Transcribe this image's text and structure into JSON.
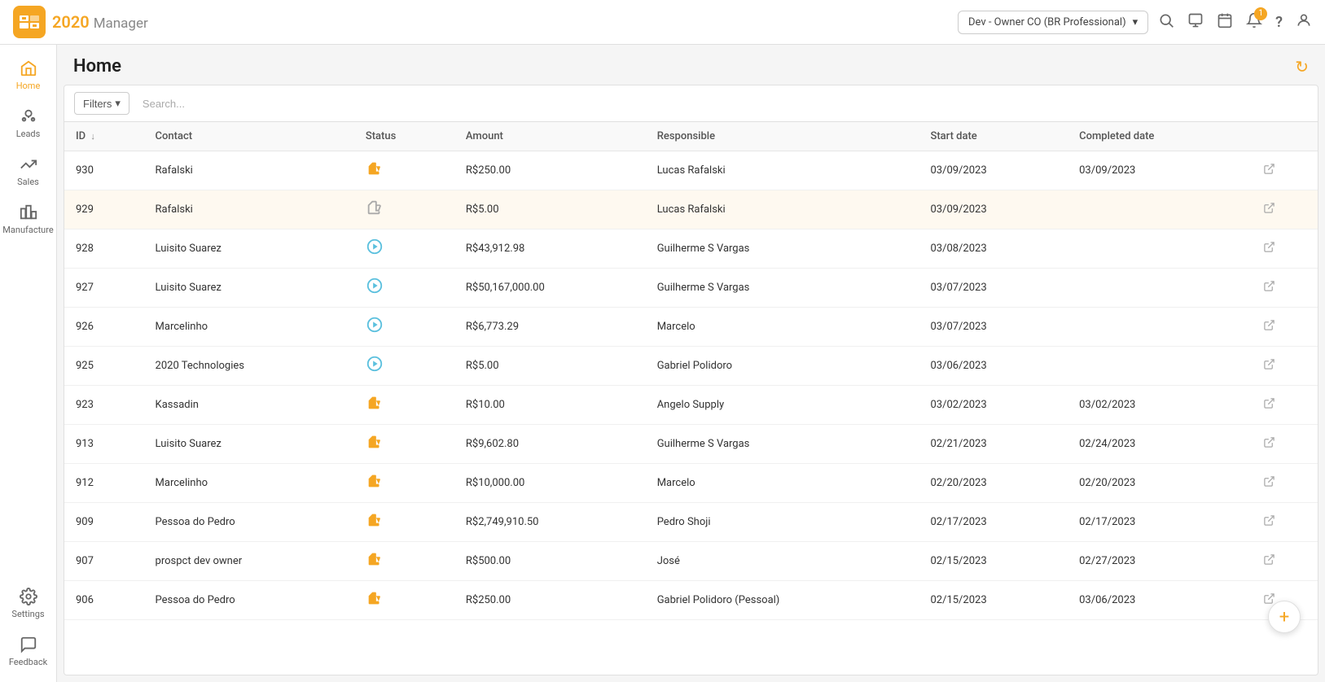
{
  "app": {
    "logo_number": "20",
    "logo_suffix": "20",
    "logo_sub": "Manager"
  },
  "topnav": {
    "env_label": "Dev - Owner CO (BR Professional)",
    "env_chevron": "▾",
    "search_icon": "🔍",
    "chat_icon": "💬",
    "calendar_icon": "📅",
    "notification_icon": "🔔",
    "notification_count": "1",
    "help_icon": "?",
    "user_icon": "👤"
  },
  "sidebar": {
    "home_label": "Home",
    "leads_label": "Leads",
    "sales_label": "Sales",
    "manufacture_label": "Manufacture",
    "settings_label": "Settings",
    "feedback_label": "Feedback"
  },
  "page": {
    "title": "Home",
    "refresh_icon": "↻"
  },
  "filters": {
    "button_label": "Filters",
    "search_placeholder": "Search..."
  },
  "table": {
    "columns": [
      {
        "key": "id",
        "label": "ID",
        "sortable": true,
        "sort_dir": "↓"
      },
      {
        "key": "contact",
        "label": "Contact"
      },
      {
        "key": "status",
        "label": "Status"
      },
      {
        "key": "amount",
        "label": "Amount"
      },
      {
        "key": "responsible",
        "label": "Responsible"
      },
      {
        "key": "start_date",
        "label": "Start date"
      },
      {
        "key": "completed_date",
        "label": "Completed date"
      },
      {
        "key": "actions",
        "label": ""
      }
    ],
    "rows": [
      {
        "id": "930",
        "contact": "Rafalski",
        "status": "approved",
        "amount": "R$250.00",
        "responsible": "Lucas Rafalski",
        "start_date": "03/09/2023",
        "completed_date": "03/09/2023",
        "highlighted": false
      },
      {
        "id": "929",
        "contact": "Rafalski",
        "status": "processing",
        "amount": "R$5.00",
        "responsible": "Lucas Rafalski",
        "start_date": "03/09/2023",
        "completed_date": "",
        "highlighted": true
      },
      {
        "id": "928",
        "contact": "Luisito Suarez",
        "status": "pending",
        "amount": "R$43,912.98",
        "responsible": "Guilherme S Vargas",
        "start_date": "03/08/2023",
        "completed_date": "",
        "highlighted": false
      },
      {
        "id": "927",
        "contact": "Luisito Suarez",
        "status": "pending",
        "amount": "R$50,167,000.00",
        "responsible": "Guilherme S Vargas",
        "start_date": "03/07/2023",
        "completed_date": "",
        "highlighted": false
      },
      {
        "id": "926",
        "contact": "Marcelinho",
        "status": "pending",
        "amount": "R$6,773.29",
        "responsible": "Marcelo",
        "start_date": "03/07/2023",
        "completed_date": "",
        "highlighted": false
      },
      {
        "id": "925",
        "contact": "2020 Technologies",
        "status": "pending",
        "amount": "R$5.00",
        "responsible": "Gabriel Polidoro",
        "start_date": "03/06/2023",
        "completed_date": "",
        "highlighted": false
      },
      {
        "id": "923",
        "contact": "Kassadin",
        "status": "approved",
        "amount": "R$10.00",
        "responsible": "Angelo Supply",
        "start_date": "03/02/2023",
        "completed_date": "03/02/2023",
        "highlighted": false
      },
      {
        "id": "913",
        "contact": "Luisito Suarez",
        "status": "approved",
        "amount": "R$9,602.80",
        "responsible": "Guilherme S Vargas",
        "start_date": "02/21/2023",
        "completed_date": "02/24/2023",
        "highlighted": false
      },
      {
        "id": "912",
        "contact": "Marcelinho",
        "status": "approved",
        "amount": "R$10,000.00",
        "responsible": "Marcelo",
        "start_date": "02/20/2023",
        "completed_date": "02/20/2023",
        "highlighted": false
      },
      {
        "id": "909",
        "contact": "Pessoa do Pedro",
        "status": "approved",
        "amount": "R$2,749,910.50",
        "responsible": "Pedro Shoji",
        "start_date": "02/17/2023",
        "completed_date": "02/17/2023",
        "highlighted": false
      },
      {
        "id": "907",
        "contact": "prospct dev owner",
        "status": "approved",
        "amount": "R$500.00",
        "responsible": "José",
        "start_date": "02/15/2023",
        "completed_date": "02/27/2023",
        "highlighted": false
      },
      {
        "id": "906",
        "contact": "Pessoa do Pedro",
        "status": "approved",
        "amount": "R$250.00",
        "responsible": "Gabriel Polidoro (Pessoal)",
        "start_date": "02/15/2023",
        "completed_date": "03/06/2023",
        "highlighted": false
      }
    ]
  },
  "fab": {
    "icon": "+"
  }
}
